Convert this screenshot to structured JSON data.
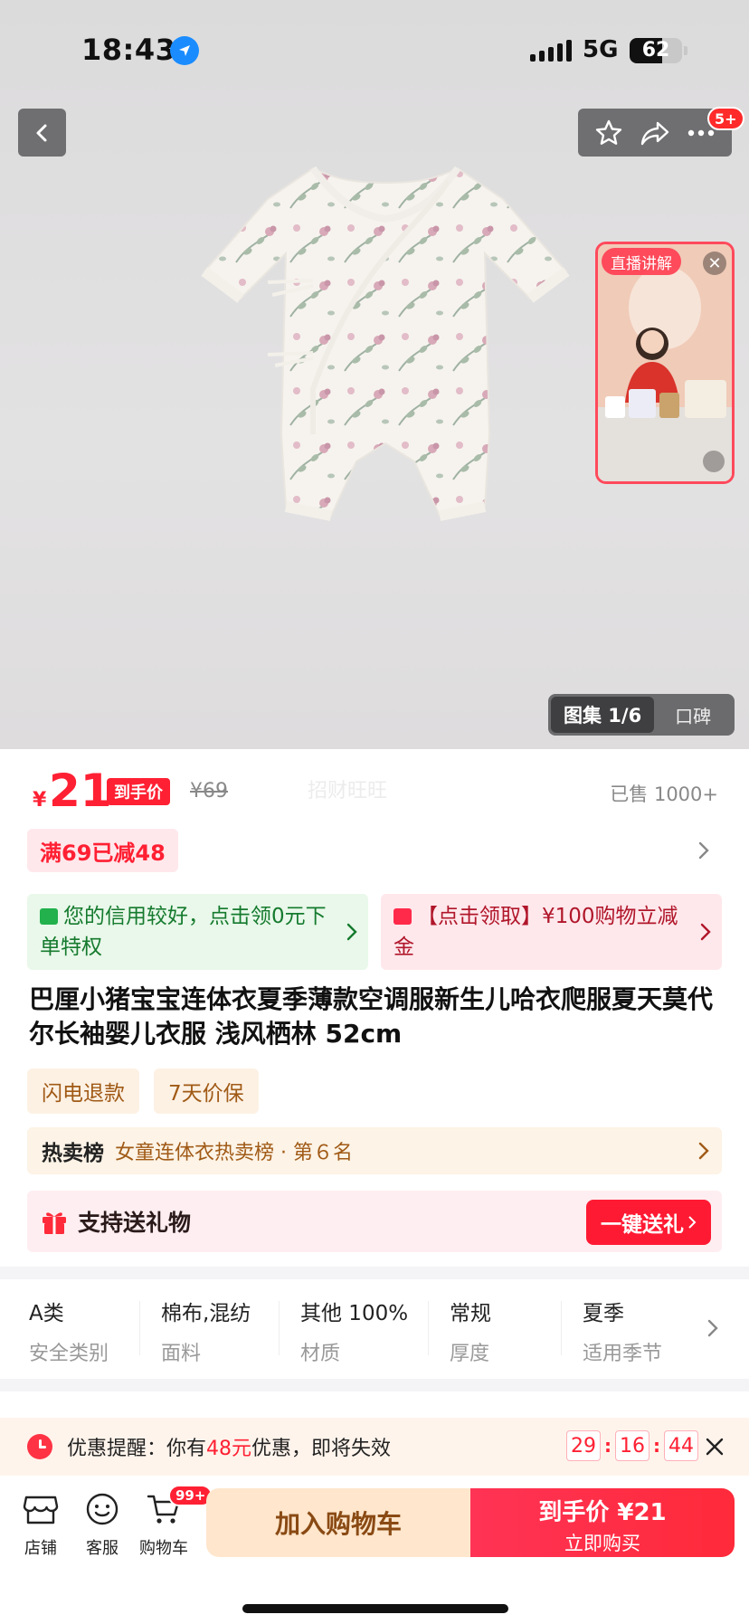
{
  "status_bar": {
    "time": "18:43",
    "network": "5G",
    "battery": "62"
  },
  "nav": {
    "more_badge": "5+",
    "back_icon": "chevron-left-icon",
    "star_icon": "star-icon",
    "share_icon": "share-icon",
    "more_icon": "more-dots-icon"
  },
  "live": {
    "label": "直播讲解",
    "close": "✕"
  },
  "gallery": {
    "active_tab": "图集 1/6",
    "other_tab": "口碑"
  },
  "price": {
    "currency": "¥",
    "amount": "21",
    "tag": "到手价",
    "original": "¥69",
    "watermark": "招财旺旺",
    "sold": "已售 1000+"
  },
  "promo": {
    "tag": "满69已减48"
  },
  "benefits": [
    {
      "text": "您的信用较好，点击领0元下单特权",
      "icon": "shopping-bag-icon"
    },
    {
      "text": "【点击领取】¥100购物立减金",
      "icon": "card-icon"
    }
  ],
  "product": {
    "title": "巴厘小猪宝宝连体衣夏季薄款空调服新生儿哈衣爬服夏天莫代尔长袖婴儿衣服 浅风栖林 52cm"
  },
  "services": [
    "闪电退款",
    "7天价保"
  ],
  "rank": {
    "badge": "热卖榜",
    "text": "女童连体衣热卖榜 · 第６名"
  },
  "gift": {
    "text": "支持送礼物",
    "button": "一键送礼"
  },
  "specs": [
    {
      "value": "A类",
      "key": "安全类别"
    },
    {
      "value": "棉布,混纺",
      "key": "面料"
    },
    {
      "value": "其他 100%",
      "key": "材质"
    },
    {
      "value": "常规",
      "key": "厚度"
    },
    {
      "value": "夏季",
      "key": "适用季节"
    }
  ],
  "reminder": {
    "prefix": "优惠提醒：你有",
    "amount": "48元",
    "suffix": "优惠，即将失效",
    "timer": [
      "29",
      "16",
      "44"
    ]
  },
  "bottom_bar": {
    "store": "店铺",
    "service": "客服",
    "cart": "购物车",
    "cart_badge": "99+",
    "add_to_cart": "加入购物车",
    "buy_line1": "到手价 ¥21",
    "buy_line2": "立即购买"
  },
  "colors": {
    "accent": "#ff2033",
    "cart_bg": "#ffe6cc",
    "green_bg": "#e9f8ea",
    "pink_bg": "#ffe8ec"
  }
}
